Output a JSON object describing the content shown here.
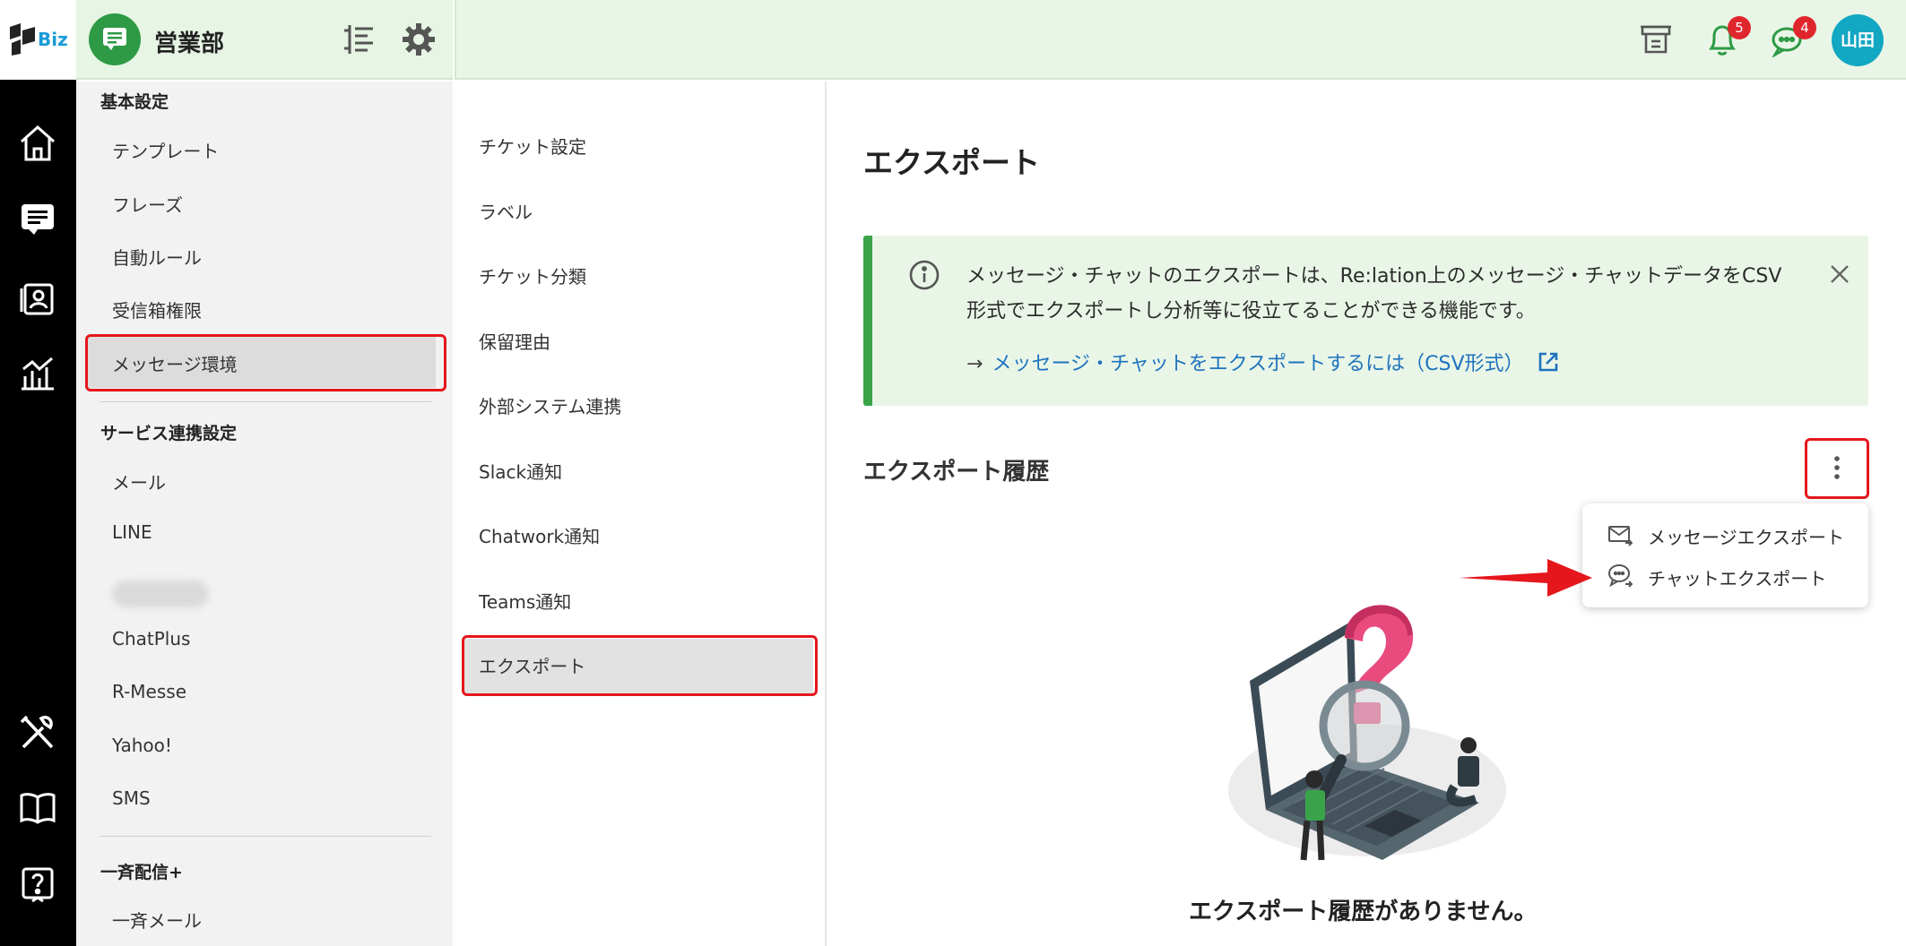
{
  "app": {
    "logo_text": "Biz",
    "team_name": "営業部",
    "user_avatar": "山田"
  },
  "header": {
    "notifications_count": "5",
    "chat_count": "4",
    "icons": [
      "ticket-stack-icon",
      "bell-icon",
      "chat-bubble-icon"
    ]
  },
  "rail": {
    "icons": [
      "home-icon",
      "tickets-icon",
      "contacts-icon",
      "analytics-icon",
      "tools-icon",
      "book-icon",
      "help-icon"
    ]
  },
  "settings_nav": {
    "sections": [
      {
        "heading": "基本設定",
        "items": [
          "テンプレート",
          "フレーズ",
          "自動ルール",
          "受信箱権限",
          "メッセージ環境"
        ]
      },
      {
        "heading": "サービス連携設定",
        "items": [
          "メール",
          "LINE",
          "ChatPlus",
          "R-Messe",
          "Yahoo!",
          "SMS"
        ]
      },
      {
        "heading": "一斉配信+",
        "items": [
          "一斉メール"
        ]
      }
    ],
    "selected": "メッセージ環境"
  },
  "sub_nav": {
    "items": [
      "チケット設定",
      "ラベル",
      "チケット分類",
      "保留理由",
      "外部システム連携",
      "Slack通知",
      "Chatwork通知",
      "Teams通知",
      "エクスポート"
    ],
    "selected": "エクスポート"
  },
  "main": {
    "title": "エクスポート",
    "info": {
      "text": "メッセージ・チャットのエクスポートは、Re:lation上のメッセージ・チャットデータをCSV形式でエクスポートし分析等に役立てることができる機能です。",
      "arrow": "→",
      "link": "メッセージ・チャットをエクスポートするには（CSV形式）"
    },
    "history_title": "エクスポート履歴",
    "menu": [
      {
        "label": "メッセージエクスポート",
        "icon": "mail-export-icon"
      },
      {
        "label": "チャットエクスポート",
        "icon": "chat-export-icon"
      }
    ],
    "empty_text": "エクスポート履歴がありません。"
  },
  "colors": {
    "accent_green": "#3aa349",
    "header_bg": "#e9f6e7",
    "link": "#1e73be",
    "highlight": "#e5161c",
    "badge": "#e0262d",
    "avatar": "#12a7c2"
  }
}
